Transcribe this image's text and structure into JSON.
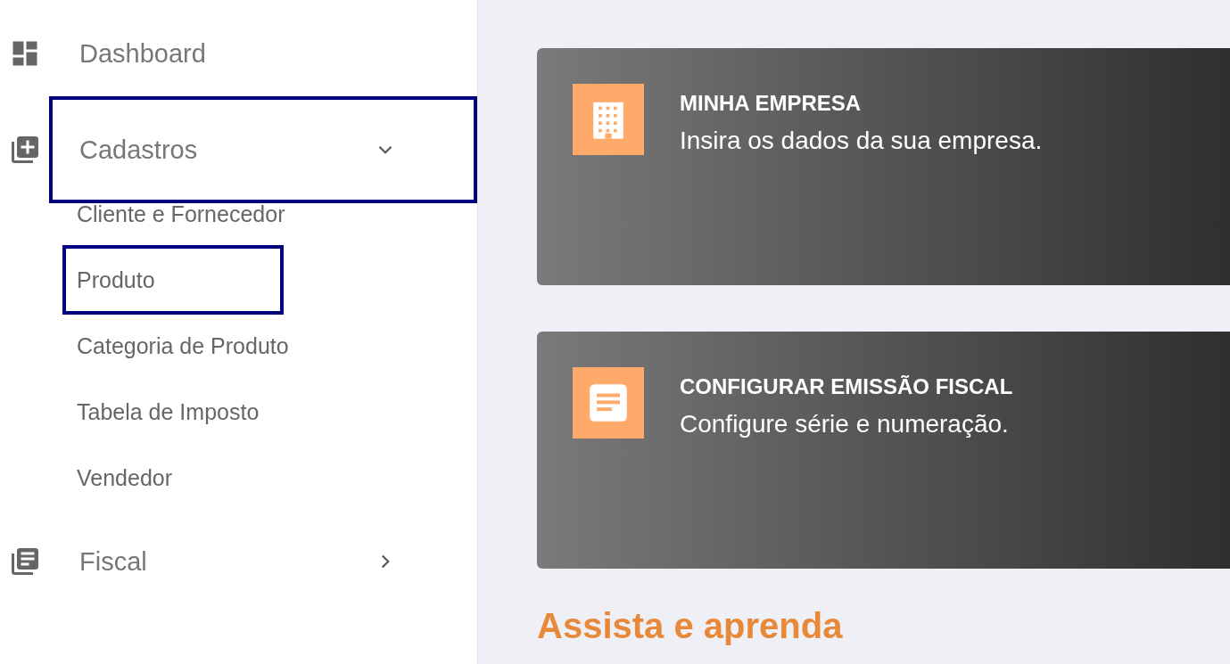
{
  "sidebar": {
    "items": [
      {
        "kind": "dashboard",
        "label": "Dashboard",
        "highlighted": false
      },
      {
        "kind": "cadastros",
        "label": "Cadastros",
        "expanded": true,
        "highlighted": true,
        "children": [
          {
            "label": "Cliente e Fornecedor",
            "highlighted": false
          },
          {
            "label": "Produto",
            "highlighted": true
          },
          {
            "label": "Categoria de Produto",
            "highlighted": false
          },
          {
            "label": "Tabela de Imposto",
            "highlighted": false
          },
          {
            "label": "Vendedor",
            "highlighted": false
          }
        ]
      },
      {
        "kind": "fiscal",
        "label": "Fiscal",
        "expanded": false,
        "highlighted": false
      }
    ]
  },
  "cards": [
    {
      "kind": "building",
      "title": "MINHA EMPRESA",
      "description": "Insira os dados da sua empresa."
    },
    {
      "kind": "document",
      "title": "CONFIGURAR EMISSÃO FISCAL",
      "description": "Configure série e numeração."
    }
  ],
  "heading": "Assista e aprenda"
}
